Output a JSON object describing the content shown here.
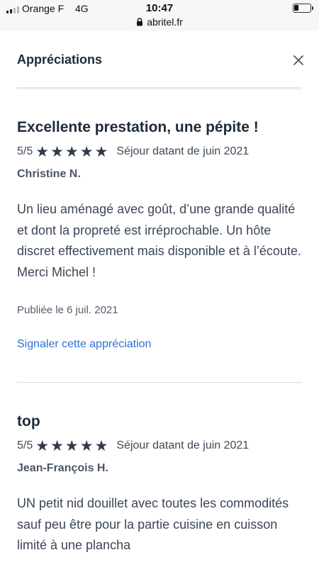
{
  "status_bar": {
    "carrier": "Orange F",
    "network": "4G",
    "time": "10:47",
    "url": "abritel.fr",
    "battery_level": 0.3
  },
  "header": {
    "title": "Appréciations"
  },
  "reviews": [
    {
      "title": "Excellente prestation, une pépite !",
      "score": "5/5",
      "stars": 5,
      "stay": "Séjour datant de juin 2021",
      "author": "Christine N.",
      "body": "Un lieu aménagé avec goût, d’une grande qualité et dont la propreté est irréprochable. Un hôte discret effectivement mais disponible et à l’écoute. Merci Michel !",
      "published": "Publiée le 6 juil. 2021",
      "report_label": "Signaler cette appréciation"
    },
    {
      "title": "top",
      "score": "5/5",
      "stars": 5,
      "stay": "Séjour datant de juin 2021",
      "author": "Jean-François H.",
      "body": "UN petit nid douillet avec toutes les commodités sauf peu être pour la partie cuisine en cuisson limité à une plancha"
    }
  ],
  "icons": {
    "close": "close-icon",
    "lock": "lock-icon",
    "star": "star-icon"
  },
  "colors": {
    "link": "#2f6fd6",
    "star": "#2f3b4b",
    "heading": "#1f2b3a"
  }
}
